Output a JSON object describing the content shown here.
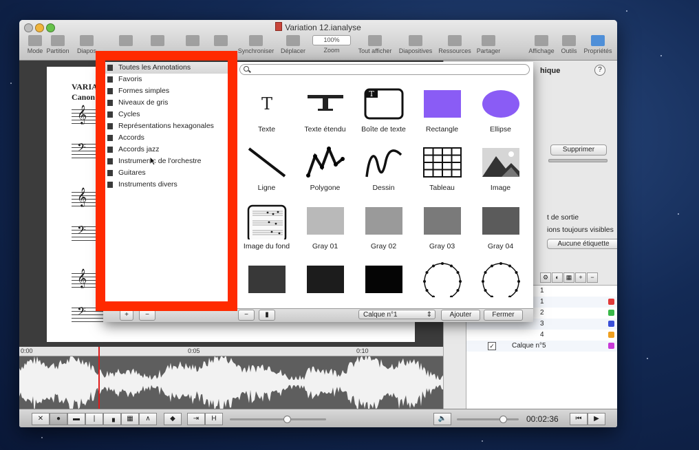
{
  "window": {
    "title": "Variation 12.ianalyse"
  },
  "toolbar": {
    "items": [
      {
        "label": "Mode"
      },
      {
        "label": "Partition"
      },
      {
        "label": "Diapos"
      },
      {
        "label": ""
      },
      {
        "label": ""
      },
      {
        "label": ""
      },
      {
        "label": ""
      },
      {
        "label": "Synchroniser"
      },
      {
        "label": "Déplacer"
      },
      {
        "label": "Zoom"
      },
      {
        "label": "Tout afficher"
      },
      {
        "label": "Diapositives"
      },
      {
        "label": "Ressources"
      },
      {
        "label": "Partager"
      },
      {
        "label": "Affichage"
      },
      {
        "label": "Outils"
      },
      {
        "label": "Propriétés"
      }
    ],
    "zoom_value": "100%"
  },
  "score": {
    "title_line1": "VARIAT",
    "title_line2": "Canon"
  },
  "categories": [
    "Toutes les Annotations",
    "Favoris",
    "Formes simples",
    "Niveaux de gris",
    "Cycles",
    "Représentations hexagonales",
    "Accords",
    "Accords jazz",
    "Instruments de l'orchestre",
    "Guitares",
    "Instruments divers"
  ],
  "annotation_grid": [
    {
      "label": "Texte",
      "icon": "text-T-icon"
    },
    {
      "label": "Texte étendu",
      "icon": "extended-text-icon"
    },
    {
      "label": "Boîte de texte",
      "icon": "text-box-icon"
    },
    {
      "label": "Rectangle",
      "icon": "rectangle-icon",
      "color": "#8a5cf5"
    },
    {
      "label": "Ellipse",
      "icon": "ellipse-icon",
      "color": "#8a5cf5"
    },
    {
      "label": "Ligne",
      "icon": "line-icon"
    },
    {
      "label": "Polygone",
      "icon": "polygon-icon"
    },
    {
      "label": "Dessin",
      "icon": "drawing-icon"
    },
    {
      "label": "Tableau",
      "icon": "table-icon"
    },
    {
      "label": "Image",
      "icon": "image-icon"
    },
    {
      "label": "Image du fond",
      "icon": "background-image-icon"
    },
    {
      "label": "Gray 01",
      "icon": "gray-swatch-icon",
      "color": "#b9b9b9"
    },
    {
      "label": "Gray 02",
      "icon": "gray-swatch-icon",
      "color": "#9a9a9a"
    },
    {
      "label": "Gray 03",
      "icon": "gray-swatch-icon",
      "color": "#7a7a7a"
    },
    {
      "label": "Gray 04",
      "icon": "gray-swatch-icon",
      "color": "#5b5b5b"
    },
    {
      "label": "",
      "icon": "gray-swatch-icon",
      "color": "#383838"
    },
    {
      "label": "",
      "icon": "gray-swatch-icon",
      "color": "#1c1c1c"
    },
    {
      "label": "",
      "icon": "gray-swatch-icon",
      "color": "#050505"
    },
    {
      "label": "",
      "icon": "cycle-icon"
    },
    {
      "label": "",
      "icon": "cycle-icon"
    }
  ],
  "panel_bottom": {
    "layer_select": "Calque n°1",
    "add_label": "Ajouter",
    "close_label": "Fermer"
  },
  "inspector": {
    "title_fragment": "hique",
    "delete_label": "Supprimer",
    "output_fragment": "t de sortie",
    "visible_fragment": "ions toujours visibles",
    "label_select": "Aucune étiquette",
    "layer_fragments": [
      "1",
      "1",
      "2",
      "3",
      "4"
    ],
    "layer5_name": "Calque n°5",
    "layer_colors": [
      "#e03a3a",
      "#3ab84a",
      "#3a4fd8",
      "#f0a020",
      "#c83ad8"
    ]
  },
  "timeline": {
    "marks": [
      "0:00",
      "0:05",
      "0:10"
    ]
  },
  "transport": {
    "timecode": "00:02:36"
  },
  "colors": {
    "highlight_frame": "#ff2a00",
    "playhead": "#e01b1b"
  }
}
